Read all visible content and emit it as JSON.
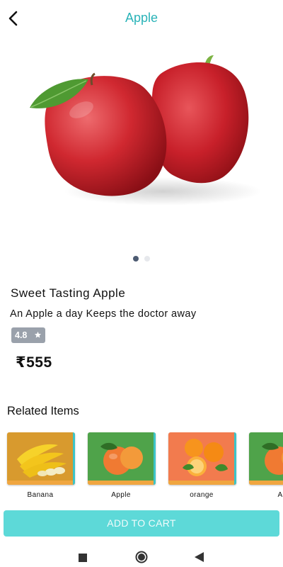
{
  "header": {
    "title": "Apple",
    "back_icon": "arrow-back-icon"
  },
  "carousel": {
    "image": "apple-image",
    "page_count": 2,
    "active_index": 0
  },
  "product": {
    "name": "Sweet Tasting Apple",
    "description": "An Apple a day Keeps the doctor away",
    "rating": "4.8",
    "rating_icon": "star-icon",
    "price": "₹555"
  },
  "related": {
    "title": "Related Items",
    "items": [
      {
        "label": "Banana",
        "image": "banana-image",
        "bg": "#d89a2e"
      },
      {
        "label": "Apple",
        "image": "apple-image",
        "bg": "#4fa34a"
      },
      {
        "label": "orange",
        "image": "orange-image",
        "bg": "#f27b4e"
      },
      {
        "label": "Ap",
        "image": "apple-image",
        "bg": "#4fa34a"
      }
    ]
  },
  "actions": {
    "add_to_cart": "ADD TO CART"
  },
  "system_nav": {
    "recents": "square-icon",
    "home": "circle-icon",
    "back": "triangle-back-icon"
  },
  "colors": {
    "accent": "#2ab3b8",
    "cart_button": "#5dd9d8",
    "rating_badge": "#9aa1ab"
  }
}
